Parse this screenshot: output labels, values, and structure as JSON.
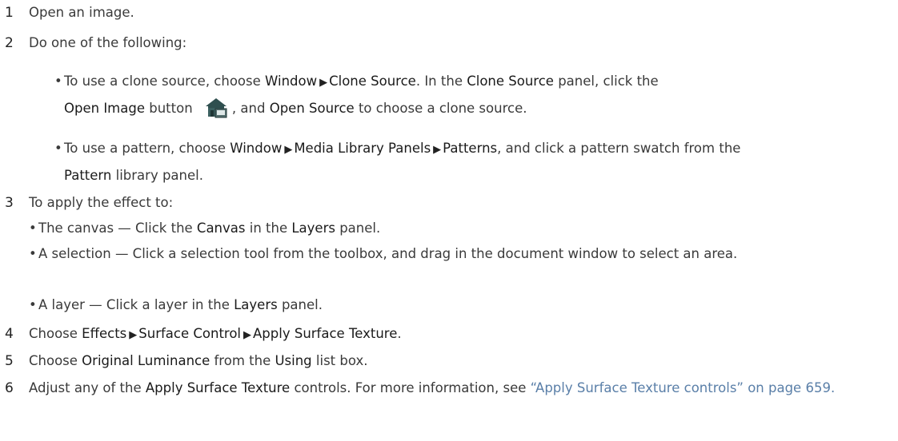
{
  "steps": [
    {
      "num": "1",
      "text": "Open an image."
    },
    {
      "num": "2",
      "text": "Do one of the following:"
    },
    {
      "num": "3",
      "text": "To apply the effect to:"
    },
    {
      "num": "4",
      "p1": "Choose ",
      "b1": "Effects",
      "b2": "Surface Control",
      "b3": "Apply Surface Texture",
      "p2": "."
    },
    {
      "num": "5",
      "p1": "Choose ",
      "b1": "Original Luminance",
      "p2": " from the ",
      "b2": "Using",
      "p3": " list box."
    },
    {
      "num": "6",
      "p1": "Adjust any of the ",
      "b1": "Apply Surface Texture",
      "p2": " controls. For more information, see ",
      "link": "“Apply Surface Texture controls” on page 659."
    }
  ],
  "step2_bullets": [
    {
      "bullet": "•",
      "p1": "To use a clone source, choose ",
      "b1": "Window",
      "b2": "Clone Source",
      "p2": ". In the ",
      "b3": "Clone Source",
      "p3": " panel, click the ",
      "b4": "Open Image",
      "p4": " button ",
      "p5": ", and ",
      "b5": "Open Source",
      "p6": " to choose a clone source.",
      "icon": "open-image-icon"
    },
    {
      "bullet": "•",
      "p1": "To use a pattern, choose ",
      "b1": "Window",
      "b2": "Media Library Panels",
      "b3": "Patterns",
      "p2": ", and click a pattern swatch from the ",
      "b4": "Pattern",
      "p3": " library panel."
    }
  ],
  "step3_bullets": [
    {
      "bullet": "•",
      "p1": "The canvas — Click the ",
      "b1": "Canvas",
      "p2": " in the ",
      "b2": "Layers",
      "p3": " panel."
    },
    {
      "bullet": "•",
      "p1": "A selection — Click a selection tool from the toolbox, and drag in the document window to select an area."
    },
    {
      "bullet": "•",
      "p1": "A layer — Click a layer in the ",
      "b1": "Layers",
      "p2": " panel."
    }
  ],
  "arrow_glyph": "▶",
  "colors": {
    "text": "#3a3a3a",
    "link": "#5a7fa8"
  }
}
